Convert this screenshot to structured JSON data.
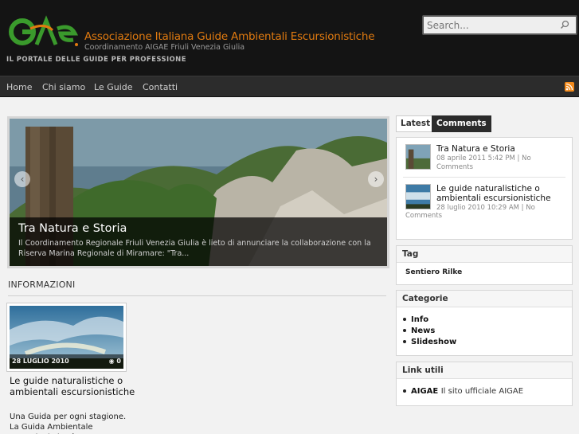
{
  "header": {
    "logo_text": "GAE",
    "site_title": "Associazione Italiana Guide Ambientali Escursionistiche",
    "site_subtitle": "Coordinamento AIGAE Friuli Venezia Giulia",
    "tagline": "IL PORTALE DELLE GUIDE PER PROFESSIONE",
    "search_placeholder": "Search...",
    "search_icon": "search-icon"
  },
  "nav": {
    "items": [
      {
        "label": "Home"
      },
      {
        "label": "Chi siamo"
      },
      {
        "label": "Le Guide"
      },
      {
        "label": "Contatti"
      }
    ],
    "rss_icon": "rss-icon"
  },
  "slideshow": {
    "title": "Tra Natura e Storia",
    "text": "Il Coordinamento Regionale Friuli Venezia Giulia è lieto di annunciare la collaborazione con la Riserva Marina Regionale di Miramare: \"Tra...",
    "prev_icon": "chevron-left-icon",
    "next_icon": "chevron-right-icon"
  },
  "section": {
    "heading": "INFORMAZIONI"
  },
  "post": {
    "date": "28 LUGLIO 2010",
    "comments": "0",
    "title": "Le guide naturalistiche o ambientali escursionistiche",
    "excerpt": "Una Guida per ogni stagione. La Guida Ambientale Escursionistica è"
  },
  "sidebar": {
    "tabs": [
      {
        "label": "Latest"
      },
      {
        "label": "Comments"
      }
    ],
    "latest": [
      {
        "title": "Tra Natura e Storia",
        "meta_line1": "08 aprile 2011 5:42 PM | No",
        "meta_line2": "Comments"
      },
      {
        "title": "Le guide naturalistiche o ambientali escursionistiche",
        "meta_line1": "28 luglio 2010 10:29 AM | No",
        "meta_line2": "Comments"
      }
    ],
    "tag_widget": {
      "title": "Tag",
      "tag": "Sentiero Rilke"
    },
    "category_widget": {
      "title": "Categorie",
      "items": [
        {
          "label": "Info"
        },
        {
          "label": "News"
        },
        {
          "label": "Slideshow"
        }
      ]
    },
    "links_widget": {
      "title": "Link utili",
      "items": [
        {
          "label": "AIGAE",
          "desc": "Il sito ufficiale AIGAE"
        }
      ]
    }
  },
  "colors": {
    "header_bg": "#141414",
    "accent_orange": "#e07a10",
    "logo_green": "#3a9a2c",
    "nav_bg": "#2c2c2c"
  }
}
